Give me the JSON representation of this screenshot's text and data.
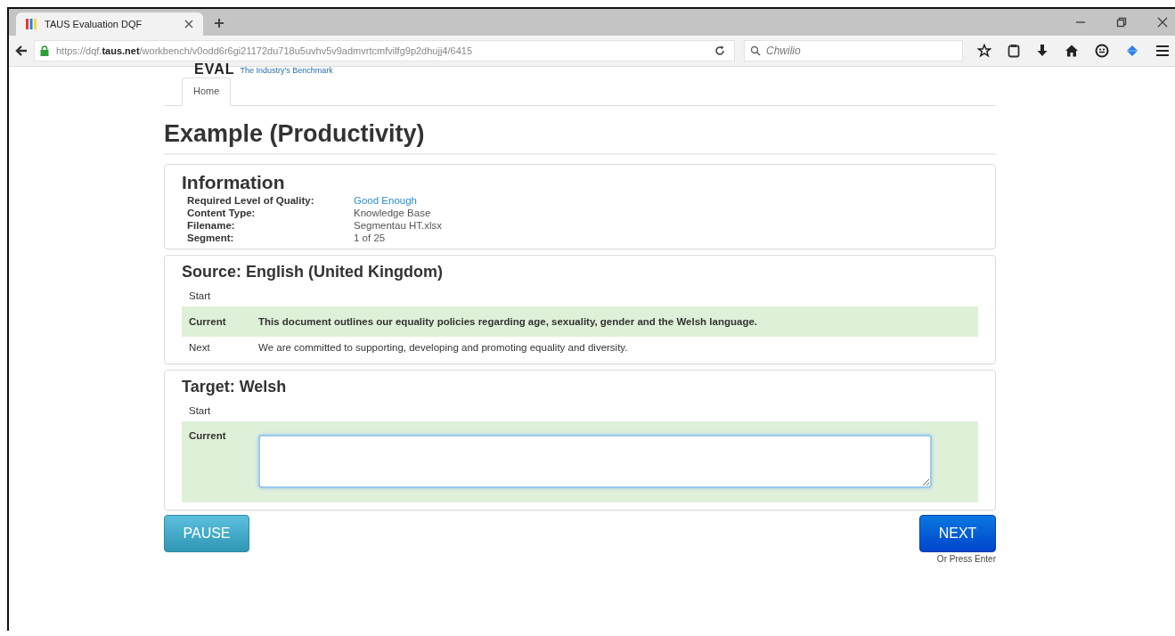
{
  "browser": {
    "tabs": [
      {
        "title": "TAUS Evaluation DQF",
        "selected": true
      }
    ],
    "url": "https://dqf.**taus.net**/workbench/v0odd6r6gi21172du718u5uvhv5v9admvrtcmfvilfg9p2dhujj4/6415",
    "search": {
      "placeholder": "Chwilio"
    }
  },
  "header": {
    "logo": "EVAL",
    "tagline": "The Industry's Benchmark"
  },
  "nav": [
    {
      "label": "Home",
      "selected": true
    }
  ],
  "title": "Example (Productivity)",
  "information": {
    "heading": "Information",
    "fields": [
      {
        "label": "Required Level of Quality:",
        "value": "Good Enough",
        "kind": "link"
      },
      {
        "label": "Content Type:",
        "value": "Knowledge Base",
        "kind": "text"
      },
      {
        "label": "Filename:",
        "value": "Segmentau HT.xlsx",
        "kind": "text"
      },
      {
        "label": "Segment:",
        "value": "1 of 25",
        "kind": "text"
      }
    ]
  },
  "source": {
    "heading": "Source: English (United Kingdom)",
    "rows": [
      {
        "label": "Start",
        "current": false
      },
      {
        "label": "Current",
        "text": "This document outlines our equality policies regarding age, sexuality, gender and the Welsh language.",
        "current": true
      },
      {
        "label": "Next",
        "text": "We are committed to supporting, developing and promoting equality and diversity.",
        "current": false
      }
    ]
  },
  "target": {
    "heading": "Target: Welsh",
    "start_label": "Start",
    "current_label": "Current"
  },
  "buttons": {
    "pause": "PAUSE",
    "next": "NEXT",
    "hint": "Or Press Enter"
  }
}
